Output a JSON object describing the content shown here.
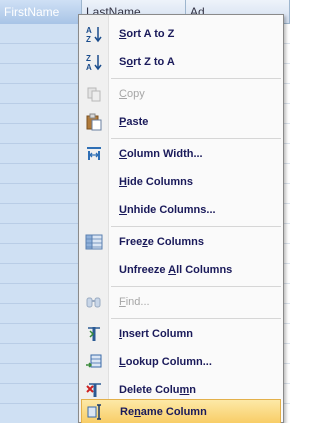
{
  "datasheet": {
    "columns": [
      "FirstName",
      "LastName",
      "Ad"
    ]
  },
  "menu": {
    "items": [
      {
        "pre": "",
        "u": "S",
        "post": "ort A to Z",
        "icon": "sort-ascending-icon",
        "enabled": true
      },
      {
        "pre": "S",
        "u": "o",
        "post": "rt Z to A",
        "icon": "sort-descending-icon",
        "enabled": true
      },
      {
        "pre": "",
        "u": "C",
        "post": "opy",
        "icon": "copy-icon",
        "enabled": false
      },
      {
        "pre": "",
        "u": "P",
        "post": "aste",
        "icon": "paste-icon",
        "enabled": true
      },
      {
        "pre": "",
        "u": "C",
        "post": "olumn Width...",
        "icon": "column-width-icon",
        "enabled": true
      },
      {
        "pre": "",
        "u": "H",
        "post": "ide Columns",
        "icon": "",
        "enabled": true
      },
      {
        "pre": "",
        "u": "U",
        "post": "nhide Columns...",
        "icon": "",
        "enabled": true
      },
      {
        "pre": "Free",
        "u": "z",
        "post": "e Columns",
        "icon": "freeze-columns-icon",
        "enabled": true
      },
      {
        "pre": "Unfreeze ",
        "u": "A",
        "post": "ll Columns",
        "icon": "",
        "enabled": true
      },
      {
        "pre": "",
        "u": "F",
        "post": "ind...",
        "icon": "find-icon",
        "enabled": false
      },
      {
        "pre": "",
        "u": "I",
        "post": "nsert Column",
        "icon": "insert-column-icon",
        "enabled": true
      },
      {
        "pre": "",
        "u": "L",
        "post": "ookup Column...",
        "icon": "lookup-column-icon",
        "enabled": true
      },
      {
        "pre": "Delete Colu",
        "u": "m",
        "post": "n",
        "icon": "delete-column-icon",
        "enabled": true
      },
      {
        "pre": "Re",
        "u": "n",
        "post": "ame Column",
        "icon": "rename-column-icon",
        "enabled": true
      }
    ]
  }
}
